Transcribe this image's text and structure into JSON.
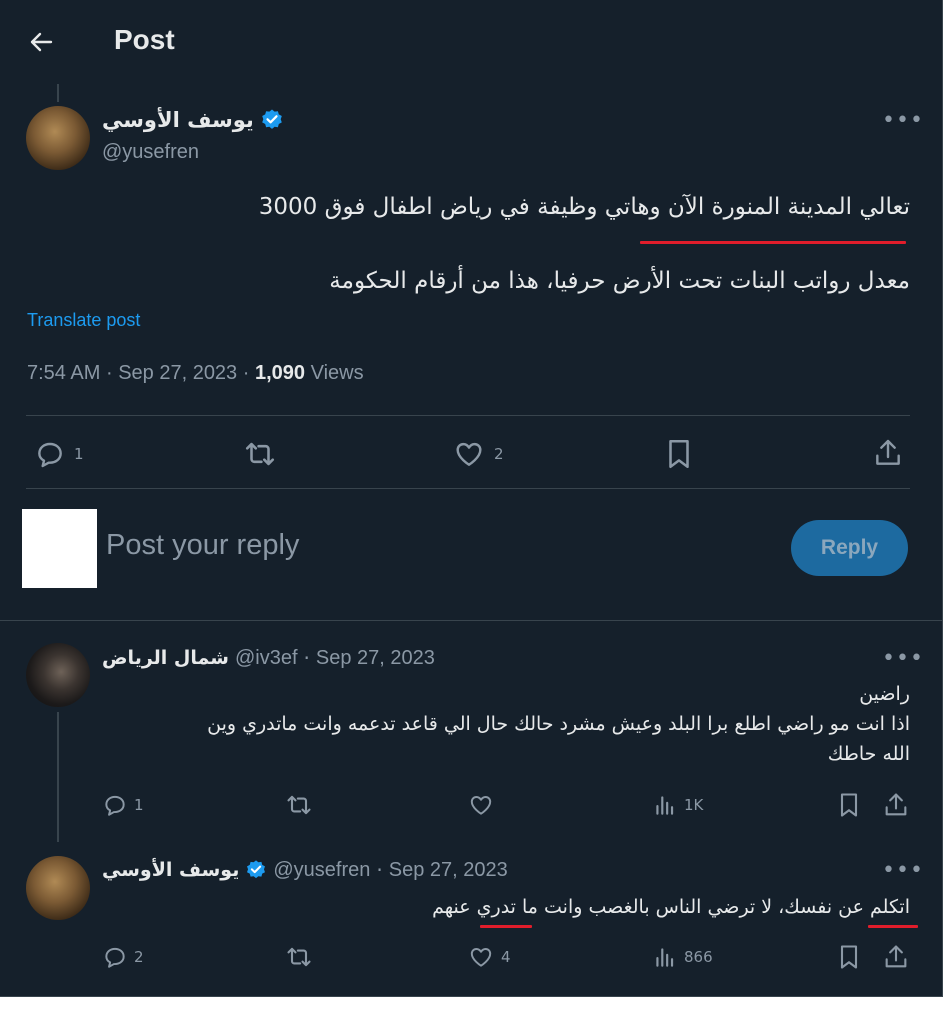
{
  "header": {
    "title": "Post"
  },
  "main_post": {
    "author_name": "يوسف الأوسي",
    "handle": "@yusefren",
    "text_line1": "تعالي المدينة المنورة الآن وهاتي وظيفة في رياض اطفال فوق 3000",
    "text_line2": "معدل رواتب البنات تحت الأرض حرفيا، هذا من أرقام الحكومة",
    "translate_label": "Translate post",
    "time": "7:54 AM",
    "date": "Sep 27, 2023",
    "views_count": "1,090",
    "views_label": "Views",
    "replies": "1",
    "likes": "2",
    "colors": {
      "verified": "#1d9bf0",
      "underline": "#e11d2b",
      "link": "#1d9bf0"
    }
  },
  "reply_box": {
    "placeholder": "Post your reply",
    "button_label": "Reply"
  },
  "replies": [
    {
      "author_name": "شمال الرياض",
      "handle": "@iv3ef",
      "date": "Sep 27, 2023",
      "text_line1": "راضين",
      "text_line2": "اذا انت مو راضي اطلع برا البلد وعيش مشرد حالك حال الي قاعد تدعمه وانت ماتدري وين",
      "text_line3": "الله حاطك",
      "replies": "1",
      "likes": "",
      "views": "1K"
    },
    {
      "author_name": "يوسف الأوسي",
      "handle": "@yusefren",
      "date": "Sep 27, 2023",
      "text_line1": "اتكلم عن نفسك، لا ترضي الناس بالغصب وانت ما تدري عنهم",
      "replies": "2",
      "likes": "4",
      "views": "866"
    }
  ]
}
